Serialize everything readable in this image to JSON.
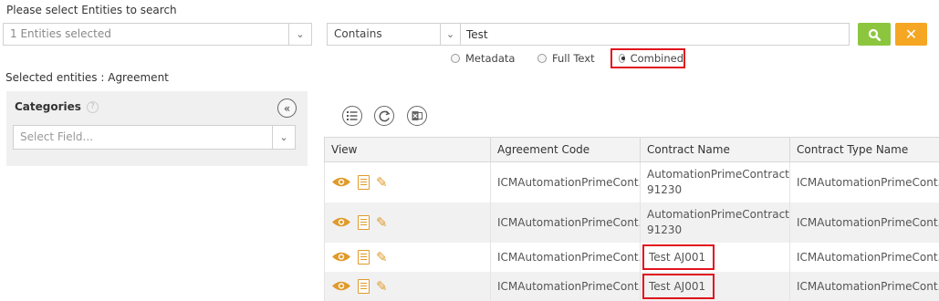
{
  "header": {
    "prompt_label": "Please select Entities to search",
    "entities_select_value": "1 Entities selected"
  },
  "search": {
    "operator_value": "Contains",
    "query_value": "Test",
    "search_button_icon": "search-icon",
    "clear_button_icon": "close-icon",
    "modes": [
      "Metadata",
      "Full Text",
      "Combined"
    ],
    "selected_mode": "Combined"
  },
  "selection": {
    "label": "Selected entities :",
    "entity": "Agreement"
  },
  "categories": {
    "title": "Categories",
    "help_icon": "?",
    "collapse_icon": "«",
    "field_placeholder": "Select Field..."
  },
  "toolbar": {
    "icons": [
      "list-icon",
      "refresh-icon",
      "export-excel-icon"
    ]
  },
  "table": {
    "columns": [
      "View",
      "Agreement Code",
      "Contract Name",
      "Contract Type Name"
    ],
    "rows": [
      {
        "agreement_code": "ICMAutomationPrimeCont...",
        "contract_name": "AutomationPrimeContract 91230",
        "contract_type": "ICMAutomationPrimeCont..."
      },
      {
        "agreement_code": "ICMAutomationPrimeCont...",
        "contract_name": "AutomationPrimeContract 91230",
        "contract_type": "ICMAutomationPrimeCont..."
      },
      {
        "agreement_code": "ICMAutomationPrimeCont...",
        "contract_name": "Test AJ001",
        "contract_type": "ICMAutomationPrimeCont..."
      },
      {
        "agreement_code": "ICMAutomationPrimeCont...",
        "contract_name": "Test AJ001",
        "contract_type": "ICMAutomationPrimeCont..."
      }
    ]
  },
  "colors": {
    "search_button": "#8cc63f",
    "clear_button": "#f5a623",
    "highlight_border": "#e0141e",
    "icon_orange": "#e09a2b"
  }
}
